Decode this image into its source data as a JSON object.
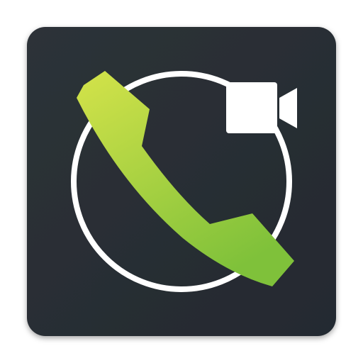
{
  "app_icon": {
    "semantic": "phone-and-video-call-app-icon",
    "background_color": "#2d3238",
    "background_gradient_end": "#242a30",
    "ring_color": "#ffffff",
    "camera_color": "#ffffff",
    "handset_gradient_top": "#d4e34a",
    "handset_gradient_bottom": "#7fc13a",
    "icons": {
      "handset": "phone-handset-icon",
      "ring": "call-ring-icon",
      "camera": "video-camera-icon"
    }
  }
}
